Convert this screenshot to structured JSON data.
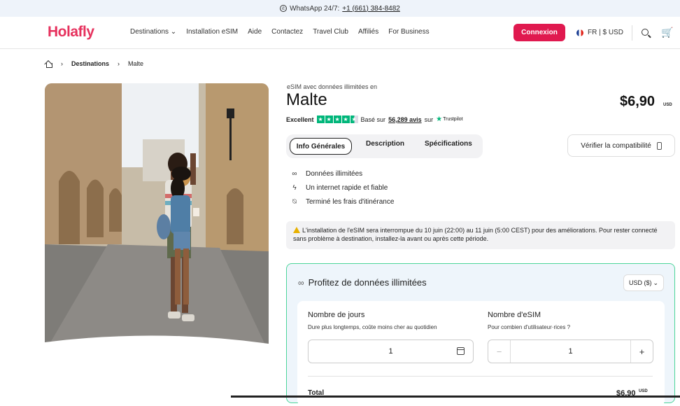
{
  "topbar": {
    "prefix": "WhatsApp 24/7:",
    "phone": "+1 (661) 384-8482"
  },
  "nav": {
    "logo": "Holafly",
    "menu": [
      "Destinations",
      "Installation eSIM",
      "Aide",
      "Contactez",
      "Travel Club",
      "Affiliés",
      "For Business"
    ],
    "login": "Connexion",
    "lang": "FR | $ USD"
  },
  "breadcrumb": {
    "section": "Destinations",
    "current": "Malte"
  },
  "product": {
    "subtitle": "eSIM avec données illimitées en",
    "title": "Malte",
    "price": "$6,90",
    "currency": "USD",
    "rating_word": "Excellent",
    "rating_stars": 4.5,
    "based_on": "Basé sur",
    "reviews": "56,289 avis",
    "on": "sur",
    "trustpilot": "Trustpilot"
  },
  "tabs": [
    "Info Générales",
    "Description",
    "Spécifications"
  ],
  "compat_label": "Vérifier la compatibilité",
  "features": [
    "Données illimitées",
    "Un internet rapide et fiable",
    "Terminé les frais d'itinérance"
  ],
  "notice": "L'installation de l'eSIM sera interrompue du 10 juin (22:00) au 11 juin (5:00 CEST) pour des améliorations. Pour rester connecté sans problème à destination, installez-la avant ou après cette période.",
  "plan": {
    "title": "Profitez de données illimitées",
    "currency_select": "USD ($)",
    "days_label": "Nombre de jours",
    "days_hint": "Dure plus longtemps, coûte moins cher au quotidien",
    "days_value": "1",
    "esim_label": "Nombre d'eSIM",
    "esim_hint": "Pour combien d'utilisateur·rices ?",
    "esim_value": "1",
    "total_label": "Total",
    "total_value": "$6,90",
    "total_currency": "USD"
  }
}
